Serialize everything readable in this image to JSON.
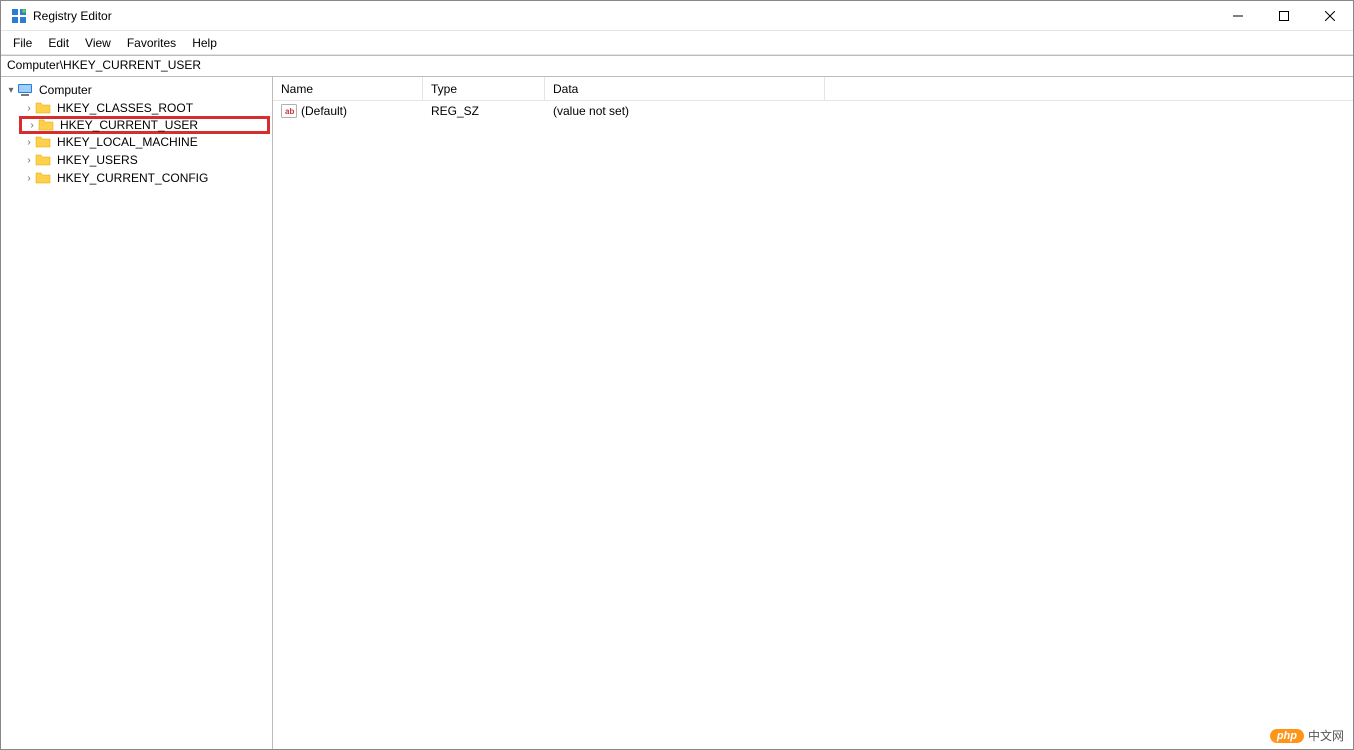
{
  "titlebar": {
    "title": "Registry Editor"
  },
  "menu": {
    "file": "File",
    "edit": "Edit",
    "view": "View",
    "favorites": "Favorites",
    "help": "Help"
  },
  "address": "Computer\\HKEY_CURRENT_USER",
  "tree": {
    "root": "Computer",
    "hives": [
      "HKEY_CLASSES_ROOT",
      "HKEY_CURRENT_USER",
      "HKEY_LOCAL_MACHINE",
      "HKEY_USERS",
      "HKEY_CURRENT_CONFIG"
    ],
    "highlighted_index": 1
  },
  "list": {
    "headers": {
      "name": "Name",
      "type": "Type",
      "data": "Data"
    },
    "rows": [
      {
        "name": "(Default)",
        "type": "REG_SZ",
        "data": "(value not set)"
      }
    ]
  },
  "watermark": {
    "pill": "php",
    "text": "中文网"
  }
}
